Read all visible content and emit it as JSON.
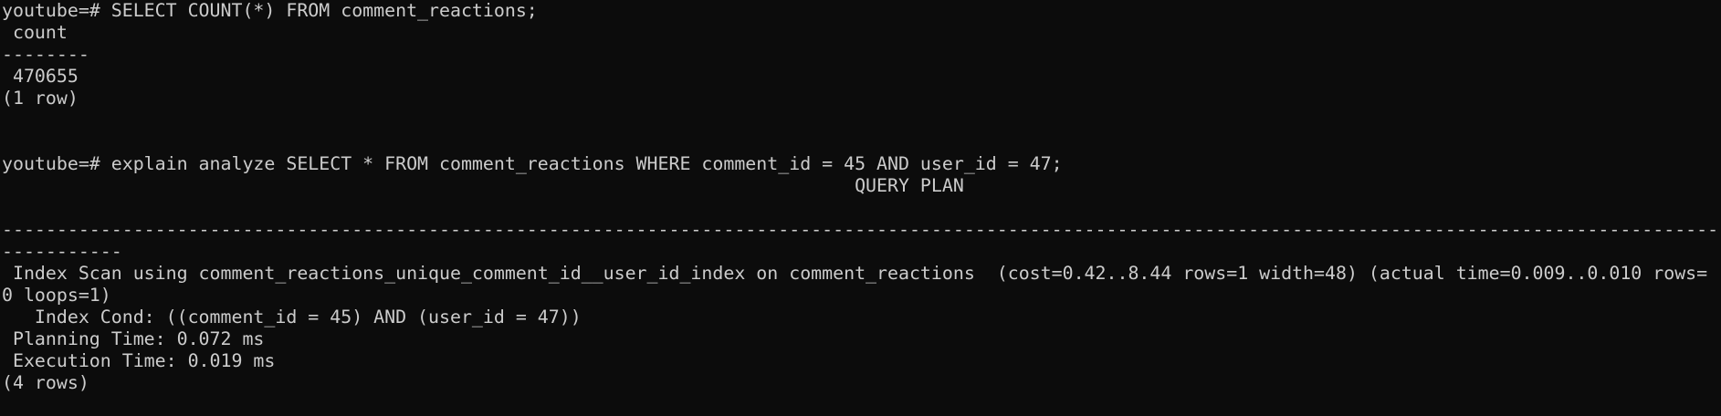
{
  "terminal": {
    "lines": [
      "youtube=# SELECT COUNT(*) FROM comment_reactions;",
      " count",
      "--------",
      " 470655",
      "(1 row)",
      "",
      "",
      "youtube=# explain analyze SELECT * FROM comment_reactions WHERE comment_id = 45 AND user_id = 47;",
      "                                                                              QUERY PLAN",
      "",
      "--------------------------------------------------------------------------------------------------------------------------------------------------------------",
      "-----------",
      " Index Scan using comment_reactions_unique_comment_id__user_id_index on comment_reactions  (cost=0.42..8.44 rows=1 width=48) (actual time=0.009..0.010 rows=",
      "0 loops=1)",
      "   Index Cond: ((comment_id = 45) AND (user_id = 47))",
      " Planning Time: 0.072 ms",
      " Execution Time: 0.019 ms",
      "(4 rows)"
    ]
  },
  "colors": {
    "background": "#0c0c0c",
    "text": "#cccccc"
  }
}
